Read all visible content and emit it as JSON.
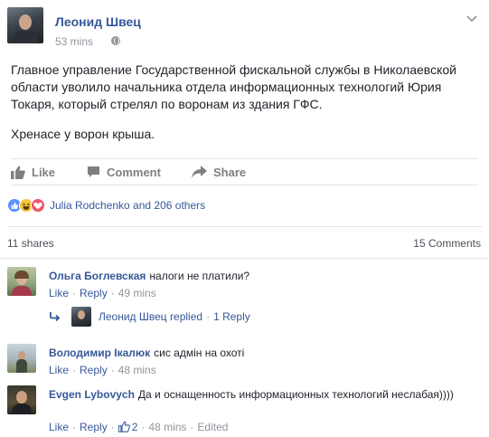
{
  "post": {
    "author": "Леонид Швец",
    "time": "53 mins",
    "paragraphs": [
      "Главное управление Государственной фискальной службы в Николаевской области уволило начальника отдела информационных технологий Юрия Токаря, который стрелял по воронам из здания ГФС.",
      "Хренасе у ворон крыша."
    ],
    "visibility_icon": "globe-icon",
    "menu_icon": "chevron-down-icon"
  },
  "actions": {
    "like": "Like",
    "comment": "Comment",
    "share": "Share"
  },
  "reactions": {
    "icons": [
      "like-icon",
      "haha-icon",
      "love-icon"
    ],
    "text": "Julia Rodchenko and 206 others"
  },
  "stats": {
    "shares": "11 shares",
    "comments": "15 Comments"
  },
  "comments": [
    {
      "author": "Ольга Боглевская",
      "text": "налоги не платили?",
      "like": "Like",
      "reply": "Reply",
      "time": "49 mins"
    },
    {
      "author": "Володимир Ікалюк",
      "text": "сис адмін на охоті",
      "like": "Like",
      "reply": "Reply",
      "time": "48 mins"
    },
    {
      "author": "Evgen Lybovych",
      "text": "Да и оснащенность информационных технологий неслабая))))",
      "like": "Like",
      "reply": "Reply",
      "likes": "2",
      "time": "48 mins",
      "edited": "Edited"
    }
  ],
  "reply_thread": {
    "author": "Леонид Швец",
    "replied": "replied",
    "count": "1 Reply"
  },
  "colors": {
    "link": "#365899",
    "meta": "#90949c",
    "divider": "#e5e5e5",
    "like_blue": "#5890ff",
    "love_red": "#f25268",
    "haha_yellow": "#f7c33b"
  }
}
